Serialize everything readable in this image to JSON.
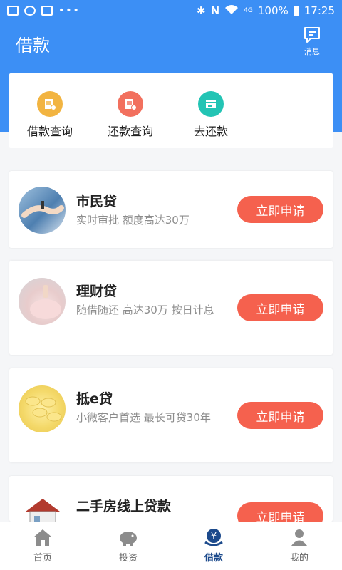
{
  "status_bar": {
    "battery": "100%",
    "time": "17:25",
    "network": "4G"
  },
  "header": {
    "title": "借款",
    "message_label": "消息"
  },
  "quick_actions": [
    {
      "label": "借款查询",
      "icon": "loan-query-icon",
      "color": "#f2b441"
    },
    {
      "label": "还款查询",
      "icon": "repay-query-icon",
      "color": "#f2705e"
    },
    {
      "label": "去还款",
      "icon": "repay-icon",
      "color": "#23c4b4"
    }
  ],
  "loans": [
    {
      "name": "市民贷",
      "desc": "实时审批 额度高达30万",
      "button": "立即申请",
      "image": "handshake-photo"
    },
    {
      "name": "理财贷",
      "desc": "随借随还 高达30万 按日计息",
      "button": "立即申请",
      "image": "piggy-bank-photo"
    },
    {
      "name": "抵e贷",
      "desc": "小微客户首选 最长可贷30年",
      "button": "立即申请",
      "image": "gold-coins-photo"
    },
    {
      "name": "二手房线上贷款",
      "desc": "",
      "button": "立即申请",
      "image": "house-photo"
    }
  ],
  "tabs": [
    {
      "label": "首页",
      "icon": "home-icon"
    },
    {
      "label": "投资",
      "icon": "piggy-icon"
    },
    {
      "label": "借款",
      "icon": "loan-icon",
      "active": true
    },
    {
      "label": "我的",
      "icon": "user-icon"
    }
  ],
  "colors": {
    "primary": "#3c8ff5",
    "accent": "#f5614e",
    "active_tab": "#1c4a8c"
  }
}
